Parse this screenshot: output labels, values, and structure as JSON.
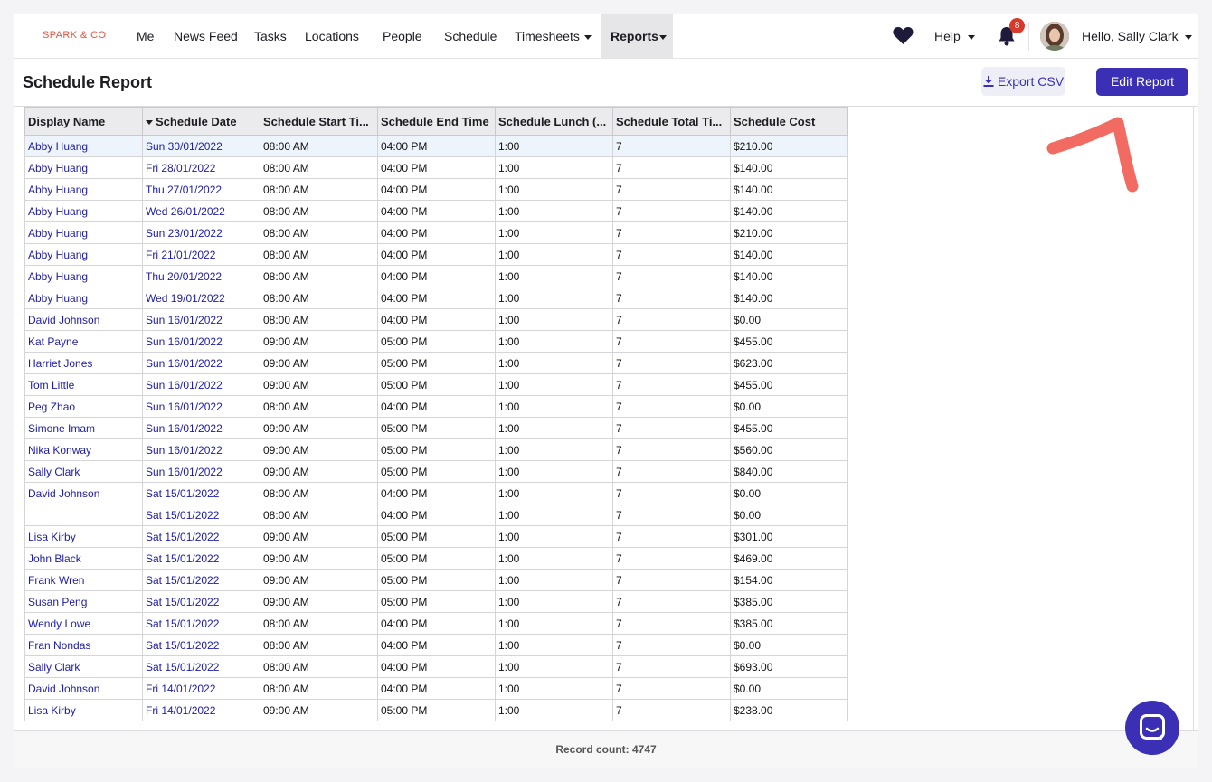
{
  "nav": {
    "brand": "SPARK & CO",
    "items": [
      "Me",
      "News Feed",
      "Tasks",
      "Locations",
      "People",
      "Schedule",
      "Timesheets",
      "Reports"
    ],
    "help": "Help",
    "notification_count": "8",
    "greeting": "Hello, Sally Clark"
  },
  "header": {
    "title": "Schedule Report",
    "export_label": "Export CSV",
    "edit_label": "Edit Report"
  },
  "table": {
    "columns": [
      "Display Name",
      "Schedule Date",
      "Schedule Start Ti...",
      "Schedule End Time",
      "Schedule Lunch (...",
      "Schedule Total Ti...",
      "Schedule Cost"
    ],
    "rows": [
      [
        "Abby Huang",
        "Sun 30/01/2022",
        "08:00 AM",
        "04:00 PM",
        "1:00",
        "7",
        "$210.00"
      ],
      [
        "Abby Huang",
        "Fri 28/01/2022",
        "08:00 AM",
        "04:00 PM",
        "1:00",
        "7",
        "$140.00"
      ],
      [
        "Abby Huang",
        "Thu 27/01/2022",
        "08:00 AM",
        "04:00 PM",
        "1:00",
        "7",
        "$140.00"
      ],
      [
        "Abby Huang",
        "Wed 26/01/2022",
        "08:00 AM",
        "04:00 PM",
        "1:00",
        "7",
        "$140.00"
      ],
      [
        "Abby Huang",
        "Sun 23/01/2022",
        "08:00 AM",
        "04:00 PM",
        "1:00",
        "7",
        "$210.00"
      ],
      [
        "Abby Huang",
        "Fri 21/01/2022",
        "08:00 AM",
        "04:00 PM",
        "1:00",
        "7",
        "$140.00"
      ],
      [
        "Abby Huang",
        "Thu 20/01/2022",
        "08:00 AM",
        "04:00 PM",
        "1:00",
        "7",
        "$140.00"
      ],
      [
        "Abby Huang",
        "Wed 19/01/2022",
        "08:00 AM",
        "04:00 PM",
        "1:00",
        "7",
        "$140.00"
      ],
      [
        "David Johnson",
        "Sun 16/01/2022",
        "08:00 AM",
        "04:00 PM",
        "1:00",
        "7",
        "$0.00"
      ],
      [
        "Kat Payne",
        "Sun 16/01/2022",
        "09:00 AM",
        "05:00 PM",
        "1:00",
        "7",
        "$455.00"
      ],
      [
        "Harriet Jones",
        "Sun 16/01/2022",
        "09:00 AM",
        "05:00 PM",
        "1:00",
        "7",
        "$623.00"
      ],
      [
        "Tom Little",
        "Sun 16/01/2022",
        "09:00 AM",
        "05:00 PM",
        "1:00",
        "7",
        "$455.00"
      ],
      [
        "Peg Zhao",
        "Sun 16/01/2022",
        "08:00 AM",
        "04:00 PM",
        "1:00",
        "7",
        "$0.00"
      ],
      [
        "Simone Imam",
        "Sun 16/01/2022",
        "09:00 AM",
        "05:00 PM",
        "1:00",
        "7",
        "$455.00"
      ],
      [
        "Nika Konway",
        "Sun 16/01/2022",
        "09:00 AM",
        "05:00 PM",
        "1:00",
        "7",
        "$560.00"
      ],
      [
        "Sally Clark",
        "Sun 16/01/2022",
        "09:00 AM",
        "05:00 PM",
        "1:00",
        "7",
        "$840.00"
      ],
      [
        "David Johnson",
        "Sat 15/01/2022",
        "08:00 AM",
        "04:00 PM",
        "1:00",
        "7",
        "$0.00"
      ],
      [
        "",
        "Sat 15/01/2022",
        "08:00 AM",
        "04:00 PM",
        "1:00",
        "7",
        "$0.00"
      ],
      [
        "Lisa Kirby",
        "Sat 15/01/2022",
        "09:00 AM",
        "05:00 PM",
        "1:00",
        "7",
        "$301.00"
      ],
      [
        "John Black",
        "Sat 15/01/2022",
        "09:00 AM",
        "05:00 PM",
        "1:00",
        "7",
        "$469.00"
      ],
      [
        "Frank Wren",
        "Sat 15/01/2022",
        "09:00 AM",
        "05:00 PM",
        "1:00",
        "7",
        "$154.00"
      ],
      [
        "Susan Peng",
        "Sat 15/01/2022",
        "09:00 AM",
        "05:00 PM",
        "1:00",
        "7",
        "$385.00"
      ],
      [
        "Wendy Lowe",
        "Sat 15/01/2022",
        "08:00 AM",
        "04:00 PM",
        "1:00",
        "7",
        "$385.00"
      ],
      [
        "Fran Nondas",
        "Sat 15/01/2022",
        "08:00 AM",
        "04:00 PM",
        "1:00",
        "7",
        "$0.00"
      ],
      [
        "Sally Clark",
        "Sat 15/01/2022",
        "08:00 AM",
        "04:00 PM",
        "1:00",
        "7",
        "$693.00"
      ],
      [
        "David Johnson",
        "Fri 14/01/2022",
        "08:00 AM",
        "04:00 PM",
        "1:00",
        "7",
        "$0.00"
      ],
      [
        "Lisa Kirby",
        "Fri 14/01/2022",
        "09:00 AM",
        "05:00 PM",
        "1:00",
        "7",
        "$238.00"
      ]
    ]
  },
  "footer": {
    "record_count": "Record count: 4747"
  },
  "colors": {
    "accent": "#3b30b5",
    "brand": "#e5533f",
    "badge": "#d9392b",
    "annotation": "#f26b63",
    "link": "#1c1ca6"
  },
  "icons": [
    "heart-icon",
    "bell-icon",
    "download-icon",
    "chat-icon",
    "sort-caret-icon"
  ]
}
